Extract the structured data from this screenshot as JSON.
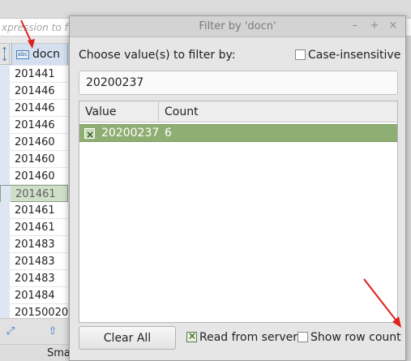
{
  "background": {
    "filter_placeholder": "xpression to f",
    "column_header": "docn",
    "rows": [
      "201441",
      "201446",
      "201446",
      "201446",
      "201460",
      "201460",
      "201460",
      "201461",
      "201461",
      "201461",
      "201483",
      "201483",
      "201483",
      "201484",
      "20150020"
    ],
    "selected_row_index": 7,
    "bottom_tab_label": "Sma"
  },
  "dialog": {
    "title": "Filter by 'docn'",
    "prompt": "Choose value(s) to filter by:",
    "case_insensitive_label": "Case-insensitive",
    "case_insensitive_checked": false,
    "search_value": "20200237",
    "columns": {
      "value": "Value",
      "count": "Count"
    },
    "values": [
      {
        "value": "20200237",
        "count": "6",
        "checked": true
      }
    ],
    "clear_all_label": "Clear All",
    "read_from_server_label": "Read from server",
    "read_from_server_checked": true,
    "show_row_count_label": "Show row count",
    "show_row_count_checked": false
  },
  "colors": {
    "selected_value_row": "#8fae73",
    "annotation_arrow": "#e0201b",
    "column_highlight": "#d4dfef"
  },
  "icons": {
    "window_buttons": [
      "minimize-icon",
      "maximize-icon",
      "close-icon"
    ]
  }
}
